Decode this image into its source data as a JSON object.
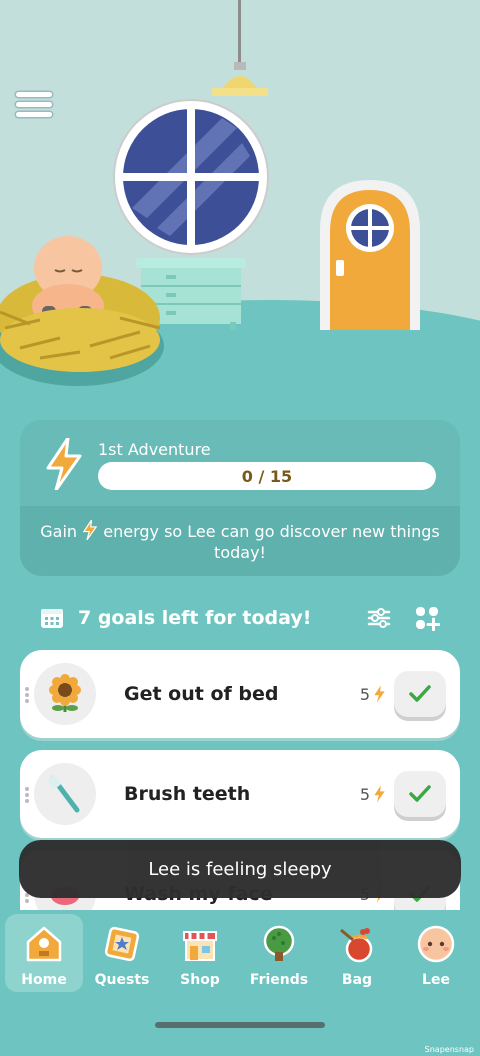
{
  "app": {
    "pet_name": "Lee"
  },
  "adventure": {
    "title": "1st Adventure",
    "progress_text": "0 / 15",
    "progress": 0.0,
    "description_pre": "Gain",
    "description_post": "energy so Lee can go discover new things today!"
  },
  "goals": {
    "header": "7 goals left for today!",
    "items": [
      {
        "label": "Get out of bed",
        "points": "5",
        "icon": "sunflower-icon"
      },
      {
        "label": "Brush teeth",
        "points": "5",
        "icon": "toothbrush-icon"
      },
      {
        "label": "Wash my face",
        "points": "5",
        "icon": "soap-icon"
      }
    ]
  },
  "toast": {
    "message": "Lee is feeling sleepy"
  },
  "nav": {
    "items": [
      {
        "label": "Home",
        "icon": "home-icon",
        "active": true
      },
      {
        "label": "Quests",
        "icon": "quests-icon"
      },
      {
        "label": "Shop",
        "icon": "shop-icon"
      },
      {
        "label": "Friends",
        "icon": "friends-tree-icon"
      },
      {
        "label": "Bag",
        "icon": "bag-icon"
      },
      {
        "label": "Lee",
        "icon": "pet-face-icon"
      }
    ]
  },
  "watermark": "Snapensnap",
  "colors": {
    "teal": "#6ec4c0",
    "energy": "#f2a93b",
    "check": "#3aa843"
  }
}
